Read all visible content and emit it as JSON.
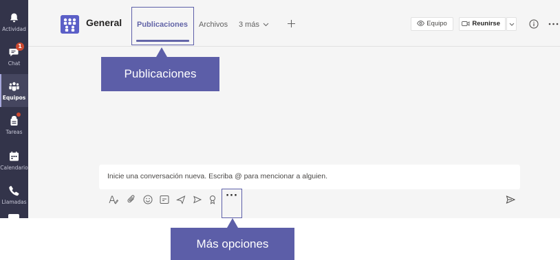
{
  "rail": {
    "items": [
      {
        "label": "Actividad",
        "icon": "bell-icon"
      },
      {
        "label": "Chat",
        "icon": "chat-icon",
        "badge": "1"
      },
      {
        "label": "Equipos",
        "icon": "teams-icon",
        "active": true
      },
      {
        "label": "Tareas",
        "icon": "tasks-icon",
        "dot": true
      },
      {
        "label": "Calendario",
        "icon": "calendar-icon"
      },
      {
        "label": "Llamadas",
        "icon": "phone-icon"
      }
    ]
  },
  "header": {
    "channel_name": "General",
    "tabs": [
      {
        "label": "Publicaciones",
        "active": true
      },
      {
        "label": "Archivos"
      },
      {
        "label": "3 más"
      }
    ],
    "team_button": "Equipo",
    "meet_button": "Reunirse"
  },
  "composer": {
    "placeholder": "Inicie una conversación nueva. Escriba @ para mencionar a alguien."
  },
  "toolbar": {
    "more_label": "···"
  },
  "callouts": {
    "tabs": "Publicaciones",
    "more": "Más opciones"
  },
  "colors": {
    "rail_bg": "#33344a",
    "accent": "#6264a7",
    "callout_bg": "#5c5ea8",
    "badge": "#cc4a31"
  }
}
